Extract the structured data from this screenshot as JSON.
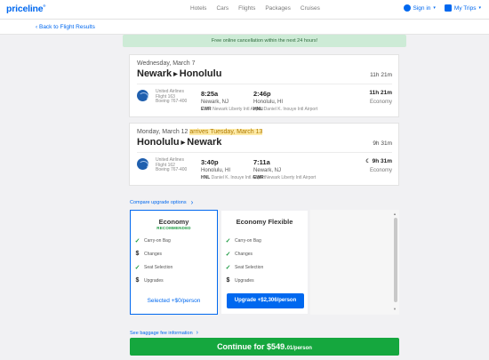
{
  "nav": {
    "logo": "priceline",
    "links": [
      "Hotels",
      "Cars",
      "Flights",
      "Packages",
      "Cruises"
    ],
    "sign_in": "Sign in",
    "my_trips": "My Trips"
  },
  "back_link": "Back to Flight Results",
  "banner": "Free online cancellation within the next 24 hours!",
  "outbound": {
    "date": "Wednesday, March 7",
    "from": "Newark",
    "to": "Honolulu",
    "total_duration": "11h 21m",
    "airline": "United Airlines",
    "flight": "Flight 163",
    "aircraft": "Boeing 767-400",
    "dep_time": "8:25a",
    "dep_city": "Newark, NJ",
    "dep_code": "EWR",
    "dep_airport": "Newark Liberty Intl Airport",
    "arr_time": "2:46p",
    "arr_city": "Honolulu, HI",
    "arr_code": "HNL",
    "arr_airport": "Daniel K. Inouye Intl Airport",
    "duration": "11h 21m",
    "cabin": "Economy"
  },
  "return": {
    "date": "Monday, March 12",
    "arrives_note": "arrives Tuesday, March 13",
    "from": "Honolulu",
    "to": "Newark",
    "total_duration": "9h 31m",
    "airline": "United Airlines",
    "flight": "Flight 162",
    "aircraft": "Boeing 767-400",
    "dep_time": "3:40p",
    "dep_city": "Honolulu, HI",
    "dep_code": "HNL",
    "dep_airport": "Daniel K. Inouye Intl Airport",
    "arr_time": "7:11a",
    "arr_city": "Newark, NJ",
    "arr_code": "EWR",
    "arr_airport": "Newark Liberty Intl Airport",
    "duration": "9h 31m",
    "cabin": "Economy"
  },
  "compare_link": "Compare upgrade options",
  "fares": [
    {
      "name": "Economy",
      "badge": "RECOMMENDED",
      "features": [
        "Carry-on Bag",
        "Changes",
        "Seat Selection",
        "Upgrades"
      ],
      "action": "Selected +$0/person"
    },
    {
      "name": "Economy Flexible",
      "features": [
        "Carry-on Bag",
        "Changes",
        "Seat Selection",
        "Upgrades"
      ],
      "action": "Upgrade +$2,306/person"
    }
  ],
  "baggage_link": "See baggage fee information",
  "continue": {
    "label": "Continue for $549.",
    "cents": "01",
    "per": "/person"
  }
}
